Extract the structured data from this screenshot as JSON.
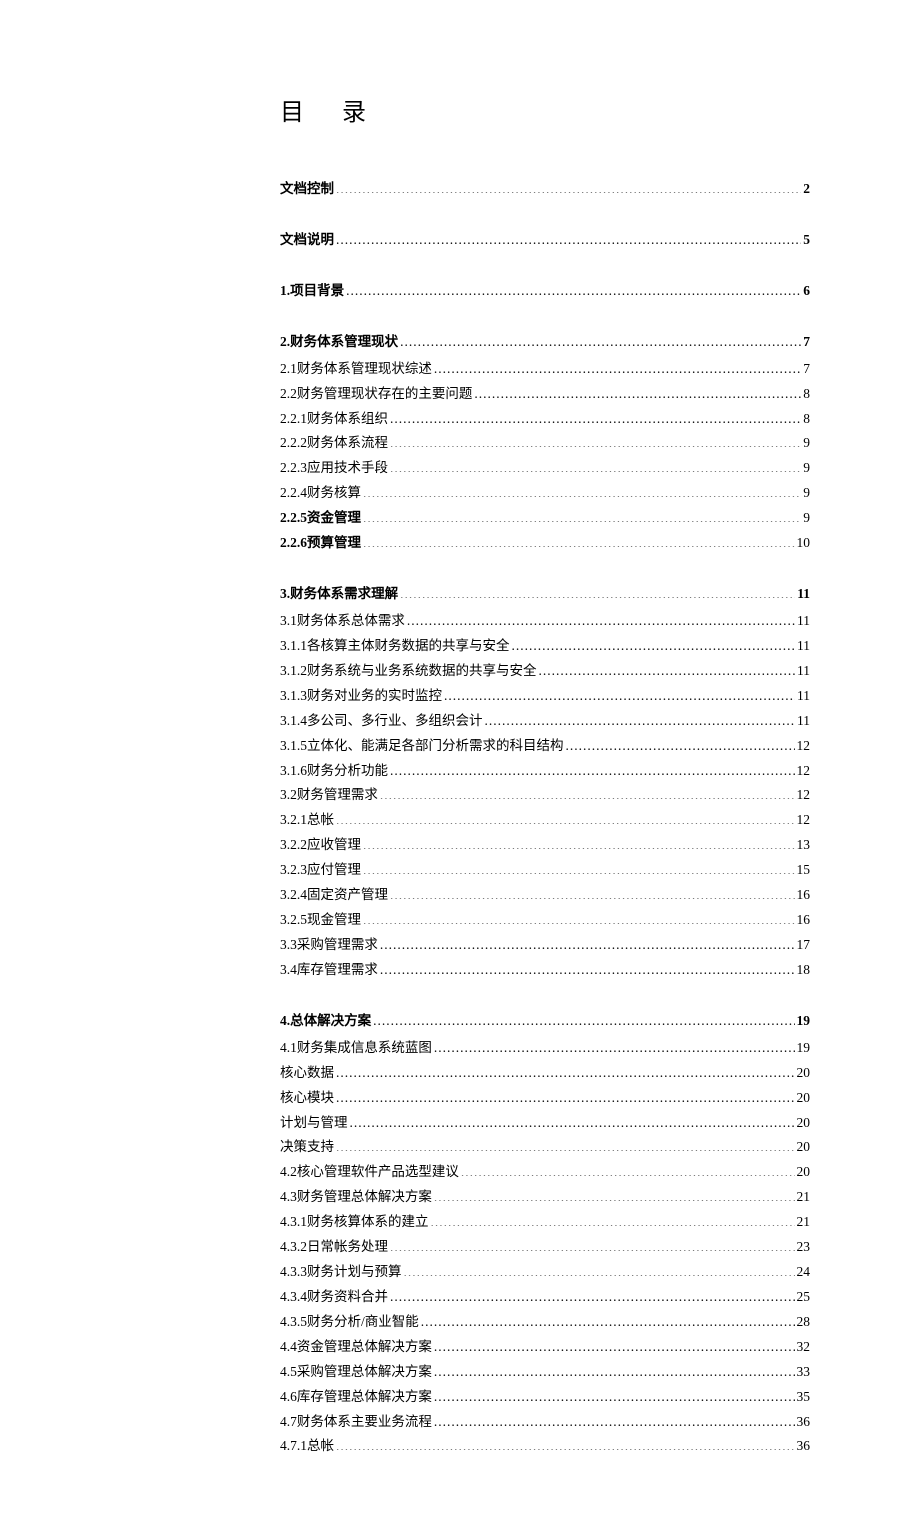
{
  "title": "目录",
  "sections": [
    {
      "heading": {
        "label": "文档控制",
        "page": "2"
      },
      "items": []
    },
    {
      "heading": {
        "label": "文档说明",
        "page": "5"
      },
      "items": []
    },
    {
      "heading": {
        "label": "1.项目背景",
        "page": "6"
      },
      "items": []
    },
    {
      "heading": {
        "label": "2.财务体系管理现状",
        "page": "7"
      },
      "items": [
        {
          "label": "2.1财务体系管理现状综述",
          "page": "7",
          "bold": false
        },
        {
          "label": "2.2财务管理现状存在的主要问题",
          "page": "8",
          "bold": false
        },
        {
          "label": "2.2.1财务体系组织",
          "page": "8",
          "bold": false
        },
        {
          "label": "2.2.2财务体系流程",
          "page": "9",
          "bold": false
        },
        {
          "label": "2.2.3应用技术手段",
          "page": "9",
          "bold": false
        },
        {
          "label": "2.2.4财务核算",
          "page": "9",
          "bold": false
        },
        {
          "label": "2.2.5资金管理",
          "page": "9",
          "bold": true
        },
        {
          "label": "2.2.6预算管理",
          "page": "10",
          "bold": true
        }
      ]
    },
    {
      "heading": {
        "label": "3.财务体系需求理解",
        "page": "11"
      },
      "items": [
        {
          "label": "3.1财务体系总体需求",
          "page": "11",
          "bold": false
        },
        {
          "label": "3.1.1各核算主体财务数据的共享与安全",
          "page": "11",
          "bold": false
        },
        {
          "label": "3.1.2财务系统与业务系统数据的共享与安全",
          "page": "11",
          "bold": false
        },
        {
          "label": "3.1.3财务对业务的实时监控",
          "page": "11",
          "bold": false
        },
        {
          "label": "3.1.4多公司、多行业、多组织会计",
          "page": "11",
          "bold": false
        },
        {
          "label": "3.1.5立体化、能满足各部门分析需求的科目结构",
          "page": "12",
          "bold": false
        },
        {
          "label": "3.1.6财务分析功能",
          "page": "12",
          "bold": false
        },
        {
          "label": "3.2财务管理需求",
          "page": "12",
          "bold": false
        },
        {
          "label": "3.2.1总帐",
          "page": "12",
          "bold": false
        },
        {
          "label": "3.2.2应收管理",
          "page": "13",
          "bold": false
        },
        {
          "label": "3.2.3应付管理",
          "page": "15",
          "bold": false
        },
        {
          "label": "3.2.4固定资产管理",
          "page": "16",
          "bold": false
        },
        {
          "label": "3.2.5现金管理",
          "page": "16",
          "bold": false
        },
        {
          "label": "3.3采购管理需求",
          "page": "17",
          "bold": false
        },
        {
          "label": "3.4库存管理需求",
          "page": "18",
          "bold": false
        }
      ]
    },
    {
      "heading": {
        "label": "4.总体解决方案",
        "page": "19"
      },
      "items": [
        {
          "label": "4.1财务集成信息系统蓝图",
          "page": "19",
          "bold": false
        },
        {
          "label": "核心数据",
          "page": "20",
          "bold": false
        },
        {
          "label": "核心模块",
          "page": "20",
          "bold": false
        },
        {
          "label": "计划与管理",
          "page": "20",
          "bold": false
        },
        {
          "label": "决策支持",
          "page": "20",
          "bold": false
        },
        {
          "label": "4.2核心管理软件产品选型建议",
          "page": "20",
          "bold": false
        },
        {
          "label": "4.3财务管理总体解决方案",
          "page": "21",
          "bold": false
        },
        {
          "label": "4.3.1财务核算体系的建立",
          "page": "21",
          "bold": false
        },
        {
          "label": "4.3.2日常帐务处理",
          "page": "23",
          "bold": false
        },
        {
          "label": "4.3.3财务计划与预算",
          "page": "24",
          "bold": false
        },
        {
          "label": "4.3.4财务资料合并",
          "page": "25",
          "bold": false
        },
        {
          "label": "4.3.5财务分析/商业智能",
          "page": "28",
          "bold": false
        },
        {
          "label": "4.4资金管理总体解决方案",
          "page": "32",
          "bold": false
        },
        {
          "label": "4.5采购管理总体解决方案",
          "page": "33",
          "bold": false
        },
        {
          "label": "4.6库存管理总体解决方案",
          "page": "35",
          "bold": false
        },
        {
          "label": "4.7财务体系主要业务流程",
          "page": "36",
          "bold": false
        },
        {
          "label": "4.7.1总帐",
          "page": "36",
          "bold": false
        }
      ]
    }
  ]
}
